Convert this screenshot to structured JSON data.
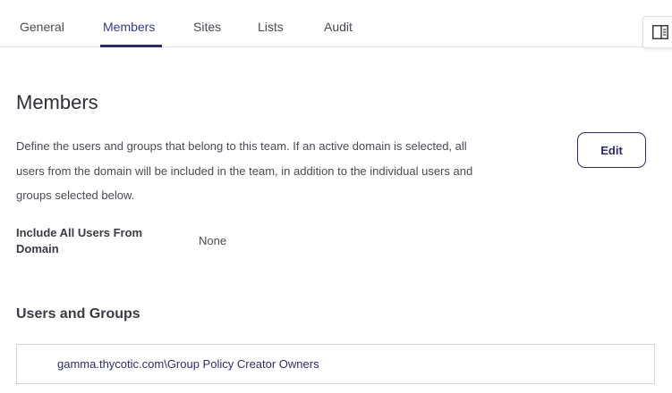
{
  "tabs": [
    {
      "label": "General",
      "active": false
    },
    {
      "label": "Members",
      "active": true
    },
    {
      "label": "Sites",
      "active": false
    },
    {
      "label": "Lists",
      "active": false
    },
    {
      "label": "Audit",
      "active": false
    }
  ],
  "panel_toggle": {
    "icon": "side-panel-icon"
  },
  "members": {
    "title": "Members",
    "description": "Define the users and groups that belong to this team. If an active domain is selected, all users from the domain will be included in the team, in addition to the individual users and groups selected below.",
    "edit_label": "Edit",
    "include_all_label": "Include All Users From Domain",
    "include_all_value": "None"
  },
  "users_groups": {
    "title": "Users and Groups",
    "items": [
      "gamma.thycotic.com\\Group Policy Creator Owners"
    ]
  },
  "colors": {
    "accent": "#2b2a6b",
    "link": "#2e2d6e",
    "border": "#d4d4dc"
  }
}
